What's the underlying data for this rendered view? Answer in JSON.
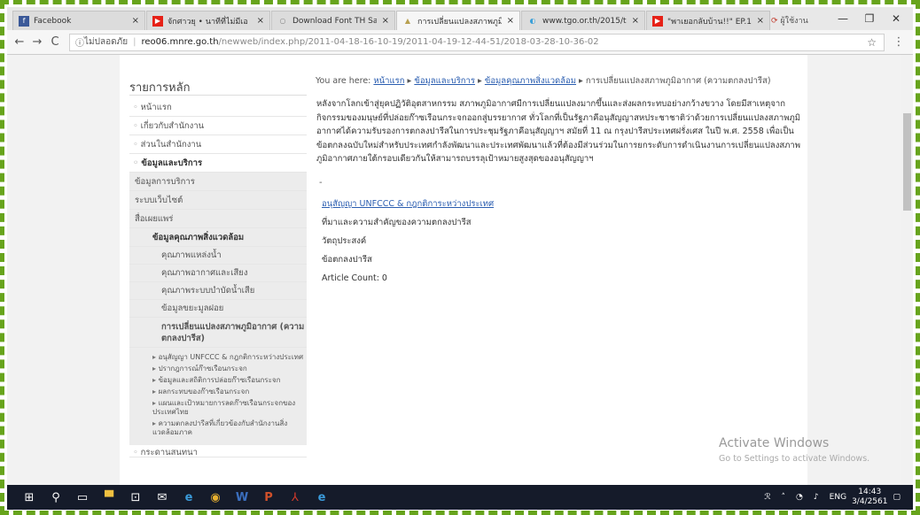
{
  "browser": {
    "tabs": [
      {
        "title": "Facebook",
        "favicon_color": "#3b5998",
        "favicon": "f"
      },
      {
        "title": "จักศาวยุ • นาทีที่ไม่มีเอ",
        "favicon_color": "#e62117",
        "favicon": "▶"
      },
      {
        "title": "Download Font TH Sa",
        "favicon_color": "#bbbbbb",
        "favicon": "○"
      },
      {
        "title": "การเปลี่ยนแปลงสภาพภูมิอ",
        "favicon_color": "#b8a050",
        "favicon": "▲"
      },
      {
        "title": "www.tgo.or.th/2015/t",
        "favicon_color": "#3aa0d8",
        "favicon": "◐"
      },
      {
        "title": "\"พาเยอกลับบ้าน!!\" EP.1",
        "favicon_color": "#e62117",
        "favicon": "▶"
      }
    ],
    "profile_label": "ผู้ใช้งาน",
    "window_controls": {
      "minimize": "—",
      "restore": "❐",
      "close": "✕"
    },
    "back": "←",
    "forward": "→",
    "reload": "C",
    "security_text": "ไม่ปลอดภัย",
    "url_host": "reo06.mnre.go.th",
    "url_path": "/newweb/index.php/2011-04-18-16-10-19/2011-04-19-12-44-51/2018-03-28-10-36-02",
    "star": "☆",
    "menu": "⋮"
  },
  "sidebar": {
    "title": "รายการหลัก",
    "items": [
      "หน้าแรก",
      "เกี่ยวกับสำนักงาน",
      "ส่วนในสำนักงาน",
      "ข้อมูลและบริการ"
    ],
    "sub_items": [
      "ข้อมูลการบริการ",
      "ระบบเว็บไซต์",
      "สื่อเผยแพร่",
      "ข้อมูลคุณภาพสิ่งแวดล้อม"
    ],
    "sub2_items": [
      "คุณภาพแหล่งน้ำ",
      "คุณภาพอากาศและเสียง",
      "คุณภาพระบบบำบัดน้ำเสีย",
      "ข้อมูลขยะมูลฝอย"
    ],
    "sub2_bold": "การเปลี่ยนแปลงสภาพภูมิอากาศ (ความตกลงปารีส)",
    "sub3_items": [
      "อนุสัญญา UNFCCC & กฎกติการะหว่างประเทศ",
      "ปรากฎการณ์ก๊าซเรือนกระจก",
      "ข้อมูลและสถิติการปล่อยก๊าซเรือนกระจก",
      "ผลกระทบของก๊าซเรือนกระจก",
      "แผนและเป้าหมายการลดก๊าซเรือนกระจกของประเทศไทย",
      "ความตกลงปารีสที่เกี่ยวข้องกับสำนักงานสิ่งแวดล้อมภาค"
    ],
    "last_item": "กระดานสนทนา"
  },
  "breadcrumb": {
    "prefix": "You are here:",
    "home": "หน้าแรก",
    "level2": "ข้อมูลและบริการ",
    "level3": "ข้อมูลคุณภาพสิ่งแวดล้อม",
    "current": "การเปลี่ยนแปลงสภาพภูมิอากาศ (ความตกลงปารีส)",
    "sep": "▸"
  },
  "content": {
    "intro": "หลังจากโลกเข้าสู่ยุคปฏิวัติอุตสาหกรรม สภาพภูมิอากาศมีการเปลี่ยนแปลงมากขึ้นและส่งผลกระทบอย่างกว้างขวาง โดยมีสาเหตุจากกิจกรรมของมนุษย์ที่ปล่อยก๊าซเรือนกระจกออกสู่บรรยากาศ ทั่วโลกที่เป็นรัฐภาคีอนุสัญญาสหประชาชาติว่าด้วยการเปลี่ยนแปลงสภาพภูมิอากาศได้ความรับรองการตกลงปารีสในการประชุมรัฐภาคีอนุสัญญาฯ สมัยที่ 11 ณ กรุงปารีสประเทศฝรั่งเศส ในปี พ.ศ. 2558 เพื่อเป็นข้อตกลงฉบับใหม่สำหรับประเทศกำลังพัฒนาและประเทศพัฒนาแล้วที่ต้องมีส่วนร่วมในการยกระดับการดำเนินงานการเปลี่ยนแปลงสภาพภูมิอากาศภายใต้กรอบเดียวกันให้สามารถบรรลุเป้าหมายสูงสุดของอนุสัญญาฯ",
    "dash": "-",
    "link1": "อนุสัญญา UNFCCC & กฎกติการะหว่างประเทศ",
    "line2": "ที่มาและความสำคัญของความตกลงปารีส",
    "line3": "วัตถุประสงค์",
    "line4": "ข้อตกลงปารีส",
    "article_count": "Article Count: 0"
  },
  "watermark": {
    "title": "Activate Windows",
    "subtitle": "Go to Settings to activate Windows."
  },
  "taskbar": {
    "icons": [
      "windows-start",
      "search",
      "task-view",
      "file-explorer",
      "store",
      "mail",
      "edge",
      "chrome",
      "word",
      "powerpoint",
      "acrobat",
      "ie"
    ],
    "tray_lang": "ENG",
    "time": "14:43",
    "date": "3/4/2561"
  }
}
